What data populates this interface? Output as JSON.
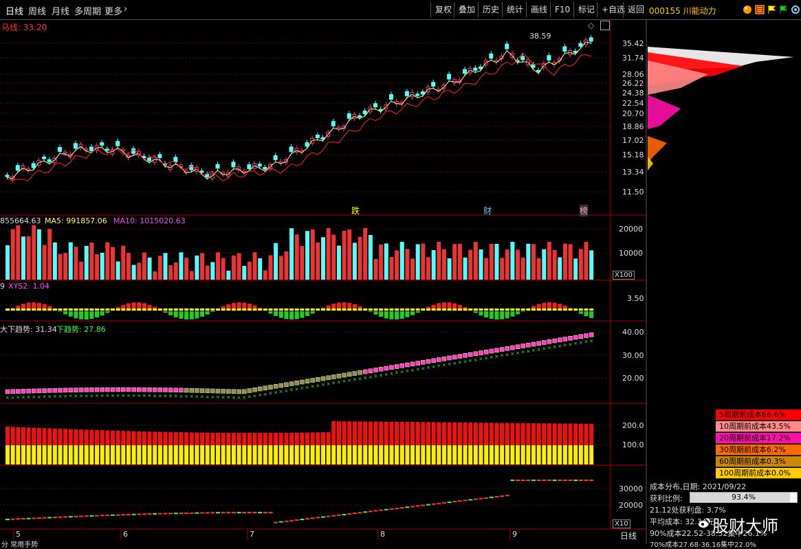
{
  "toolbar": {
    "tabs": [
      "日线",
      "周线",
      "月线",
      "多周期",
      "更多"
    ],
    "more_arrow": "›",
    "buttons": [
      "复权",
      "叠加",
      "历史",
      "统计",
      "画线",
      "F10",
      "标记",
      "+自选",
      "返回"
    ],
    "stock": "000155 川能动力",
    "icons": [
      "color-palette-icon",
      "menu-icon",
      "flag-icon",
      "green-flag-icon",
      "settings-icon"
    ]
  },
  "main_panel": {
    "ma_label": "马线: 33.20",
    "price_ticks": [
      "35.42",
      "31.74",
      "28.06",
      "26.22",
      "24.38",
      "22.54",
      "20.70",
      "18.86",
      "17.02",
      "15.18",
      "13.34",
      "11.50"
    ],
    "high_label": "38.59",
    "markers": [
      "跌",
      "财",
      "榜"
    ]
  },
  "volume_panel": {
    "header_a": "855664.63",
    "header_b": "MA5: 991857.06",
    "header_c": "MA10: 1015020.63",
    "ticks": [
      "20000",
      "10000"
    ],
    "unit": "X100"
  },
  "xys_panel": {
    "header_a": "9",
    "header_b": "XYS2: 1.04",
    "ticks": [
      "3.50"
    ]
  },
  "trend_panel": {
    "header_a": "大下趋势: 31.34",
    "header_b": "下趋势: 27.86",
    "ticks": [
      "40.00",
      "30.00",
      "20.00"
    ]
  },
  "bar_panel": {
    "ticks": [
      "200.0",
      "100.0"
    ]
  },
  "line_panel": {
    "ticks": [
      "30000",
      "20000"
    ],
    "unit": "X10"
  },
  "xaxis": {
    "months": [
      "5",
      "6",
      "7",
      "8",
      "9"
    ],
    "period": "日线",
    "bottom_text": "分  常用手势"
  },
  "cost": {
    "legend": [
      {
        "label": "5周期前成本66.6%",
        "color": "#ff0000"
      },
      {
        "label": "10周期前成本43.5%",
        "color": "#ff8080"
      },
      {
        "label": "20周期前成本17.2%",
        "color": "#ff00a0"
      },
      {
        "label": "30周期前成本6.2%",
        "color": "#ff6600"
      },
      {
        "label": "60周期前成本0.3%",
        "color": "#cc8800"
      },
      {
        "label": "100周期前成本0.0%",
        "color": "#ffcc00"
      }
    ],
    "date_line": "成本分布,日期: 2021/09/22",
    "profit_label": "获利比例:",
    "profit_value": "93.4%",
    "profit_ratio": 0.934,
    "line1": "21.12处获利盘: 3.7%",
    "line2": "平均成本: 32.34元",
    "line3": "90%成本22.52-38.32集中26.1%",
    "line4": "70%成本27.68-36.16集中22.0%"
  },
  "watermark": "股财大师"
}
